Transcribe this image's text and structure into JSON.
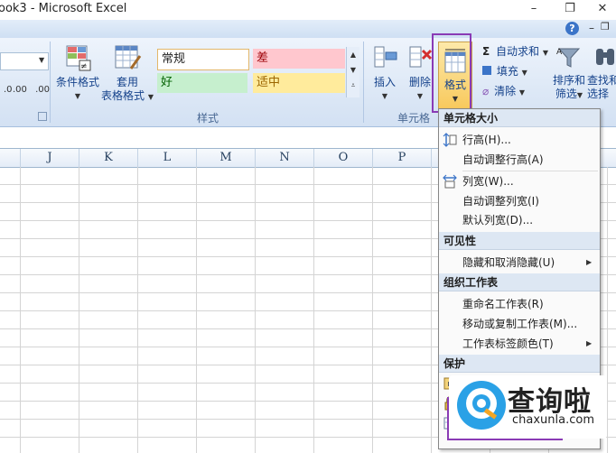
{
  "window": {
    "title": "ook3 - Microsoft Excel",
    "minimize_glyph": "–",
    "restore_glyph": "❐",
    "close_glyph": "✕"
  },
  "ribbon": {
    "decimal_increase": ".0",
    "decimal_increase_2": ".00",
    "decimal_decrease": ".00",
    "decimal_decrease_2": "→.0",
    "cond_format": "条件格式",
    "table_format_1": "套用",
    "table_format_2": "表格格式",
    "styles": {
      "normal": "常规",
      "bad": "差",
      "good": "好",
      "neutral": "适中"
    },
    "styles_group_label": "样式",
    "insert": "插入",
    "delete": "删除",
    "format": "格式",
    "cells_group_label": "单元格",
    "autosum": "自动求和",
    "fill": "填充",
    "clear": "清除",
    "sort_1": "排序和",
    "sort_2": "筛选",
    "find_1": "查找和",
    "find_2": "选择",
    "help_glyph": "?"
  },
  "columns": [
    "J",
    "K",
    "L",
    "M",
    "N",
    "O",
    "P"
  ],
  "menu": {
    "sections": [
      {
        "header": "单元格大小",
        "items": [
          "行高(H)...",
          "自动调整行高(A)",
          "列宽(W)...",
          "自动调整列宽(I)",
          "默认列宽(D)..."
        ]
      },
      {
        "header": "可见性",
        "items": [
          "隐藏和取消隐藏(U)"
        ]
      },
      {
        "header": "组织工作表",
        "items": [
          "重命名工作表(R)",
          "移动或复制工作表(M)...",
          "工作表标签颜色(T)"
        ]
      },
      {
        "header": "保护",
        "items": []
      }
    ]
  },
  "watermark": {
    "brand": "查询啦",
    "url": "chaxunla.com"
  },
  "colors": {
    "highlight": "#8a3bb5",
    "bad_style_bg": "#ffc7ce",
    "good_style_bg": "#c6efce",
    "neutral_style_bg": "#ffeb9c",
    "watermark_blue": "#2aa1e6"
  }
}
